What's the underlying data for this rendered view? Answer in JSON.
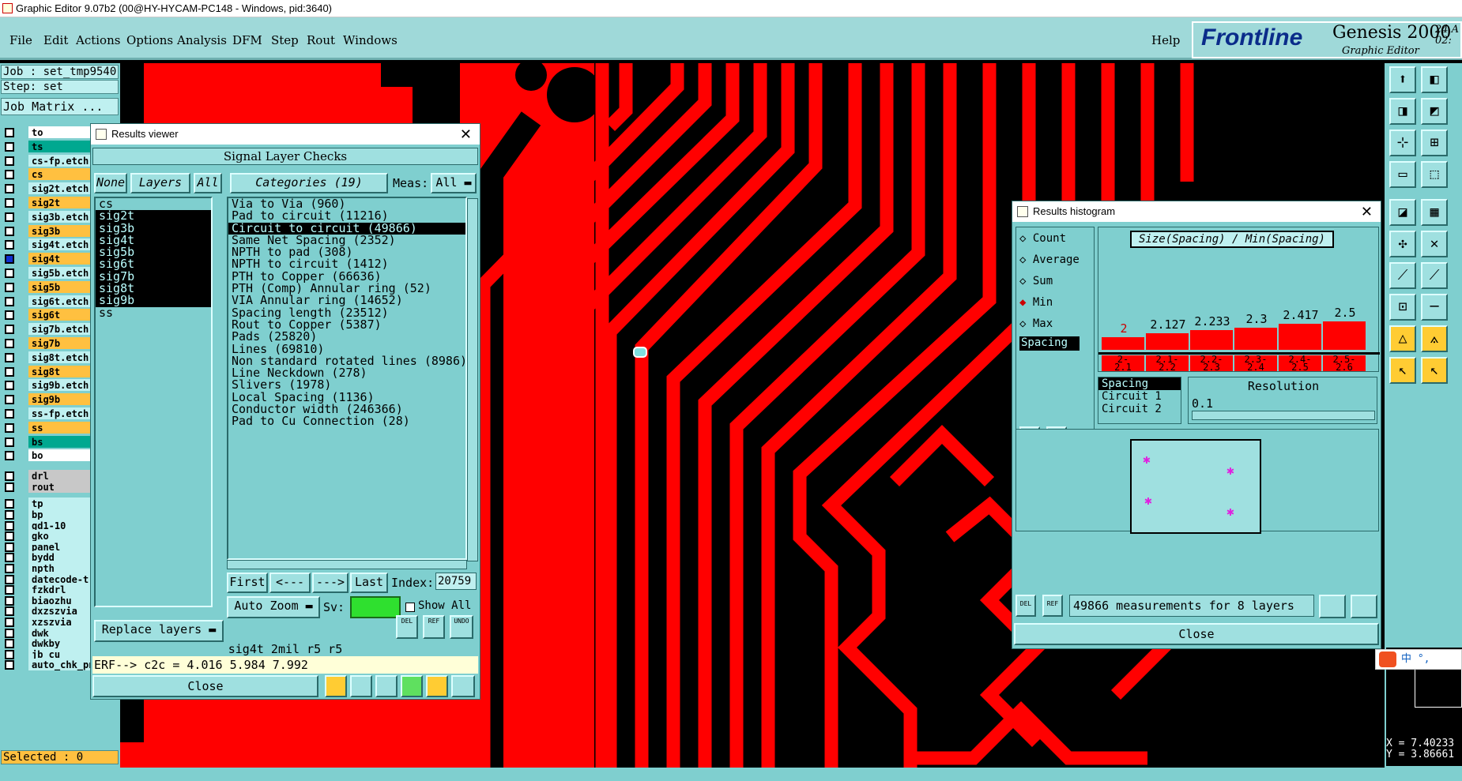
{
  "app": {
    "title": "Graphic Editor 9.07b2 (00@HY-HYCAM-PC148 - Windows, pid:3640)",
    "menu": [
      "File",
      "Edit",
      "Actions",
      "Options",
      "Analysis",
      "DFM",
      "Step",
      "Rout",
      "Windows"
    ],
    "help": "Help",
    "brand": "Frontline",
    "product": "Genesis 2000",
    "subtitle": "Graphic Editor",
    "date_line1": "24 A",
    "date_line2": "02:"
  },
  "left": {
    "job": "Job : set_tmp9540",
    "step": "Step: set",
    "job_matrix": "Job Matrix ...",
    "layers": [
      {
        "name": "to",
        "color": "#ffffff"
      },
      {
        "name": "ts",
        "color": "#00a890"
      },
      {
        "name": "cs-fp.etch",
        "color": "#bff0f0"
      },
      {
        "name": "cs",
        "color": "#ffc040"
      },
      {
        "name": "sig2t.etch",
        "color": "#bff0f0"
      },
      {
        "name": "sig2t",
        "color": "#ffc040"
      },
      {
        "name": "sig3b.etch",
        "color": "#bff0f0"
      },
      {
        "name": "sig3b",
        "color": "#ffc040"
      },
      {
        "name": "sig4t.etch",
        "color": "#bff0f0"
      },
      {
        "name": "sig4t",
        "color": "#ffc040"
      },
      {
        "name": "sig5b.etch",
        "color": "#bff0f0"
      },
      {
        "name": "sig5b",
        "color": "#ffc040"
      },
      {
        "name": "sig6t.etch",
        "color": "#bff0f0"
      },
      {
        "name": "sig6t",
        "color": "#ffc040"
      },
      {
        "name": "sig7b.etch",
        "color": "#bff0f0"
      },
      {
        "name": "sig7b",
        "color": "#ffc040"
      },
      {
        "name": "sig8t.etch",
        "color": "#bff0f0"
      },
      {
        "name": "sig8t",
        "color": "#ffc040"
      },
      {
        "name": "sig9b.etch",
        "color": "#bff0f0"
      },
      {
        "name": "sig9b",
        "color": "#ffc040"
      },
      {
        "name": "ss-fp.etch",
        "color": "#bff0f0"
      },
      {
        "name": "ss",
        "color": "#ffc040"
      },
      {
        "name": "bs",
        "color": "#00a890"
      },
      {
        "name": "bo",
        "color": "#ffffff"
      },
      {
        "name": "drl",
        "color": "#c8c8c8"
      },
      {
        "name": "rout",
        "color": "#c8c8c8"
      },
      {
        "name": "tp",
        "color": "#bff0f0"
      },
      {
        "name": "bp",
        "color": "#bff0f0"
      },
      {
        "name": "gd1-10",
        "color": "#bff0f0"
      },
      {
        "name": "gko",
        "color": "#bff0f0"
      },
      {
        "name": "panel",
        "color": "#bff0f0"
      },
      {
        "name": "bydd",
        "color": "#bff0f0"
      },
      {
        "name": "npth",
        "color": "#bff0f0"
      },
      {
        "name": "datecode-t",
        "color": "#bff0f0"
      },
      {
        "name": "fzkdrl",
        "color": "#bff0f0"
      },
      {
        "name": "biaozhu",
        "color": "#bff0f0"
      },
      {
        "name": "dxzszvia",
        "color": "#bff0f0"
      },
      {
        "name": "xzszvia",
        "color": "#bff0f0"
      },
      {
        "name": "dwk",
        "color": "#bff0f0"
      },
      {
        "name": "dwkby",
        "color": "#bff0f0"
      },
      {
        "name": "jb_cu",
        "color": "#bff0f0"
      },
      {
        "name": "auto_chk_pnl",
        "color": "#bff0f0"
      }
    ],
    "selected": "Selected : 0"
  },
  "results_viewer": {
    "title": "Results viewer",
    "header": "Signal Layer Checks",
    "none_btn": "None",
    "layers_btn": "Layers",
    "all_btn": "All",
    "categories_btn": "Categories (19)",
    "meas_label": "Meas:",
    "meas_value": "All",
    "layer_list": [
      "cs",
      "sig2t",
      "sig3b",
      "sig4t",
      "sig5b",
      "sig6t",
      "sig7b",
      "sig8t",
      "sig9b",
      "ss"
    ],
    "categories": [
      "Via to Via (960)",
      "Pad to circuit (11216)",
      "Circuit to circuit (49866)",
      "Same Net Spacing (2352)",
      "NPTH to pad (308)",
      "NPTH to circuit (1412)",
      "PTH to Copper (66636)",
      "PTH (Comp) Annular ring (52)",
      "VIA Annular ring (14652)",
      "Spacing length (23512)",
      "Rout to Copper (5387)",
      "Pads (25820)",
      "Lines (69810)",
      "Non standard rotated lines (8986)",
      "Line Neckdown (278)",
      "Slivers (1978)",
      "Local Spacing (1136)",
      "Conductor width (246366)",
      "Pad to Cu Connection (28)"
    ],
    "first": "First",
    "prev": "<---",
    "next": "--->",
    "last": "Last",
    "index_label": "Index:",
    "index_value": "20759",
    "auto_zoom": "Auto Zoom",
    "sv_label": "Sv:",
    "show_all": "Show All",
    "replace_layers": "Replace layers",
    "del": "DEL",
    "ref": "REF",
    "undo": "UNDO",
    "info_line": "sig4t 2mil  r5  r5",
    "erf_line": "ERF--> c2c = 4.016 5.984 7.992",
    "close": "Close"
  },
  "histogram": {
    "title": "Results histogram",
    "modes": [
      "Count",
      "Average",
      "Sum",
      "Min",
      "Max"
    ],
    "selected_mode": "Min",
    "chart_title": "Size(Spacing) / Min(Spacing)",
    "spacing_tag": "Spacing",
    "bar_values": [
      "2",
      "2.127",
      "2.233",
      "2.3",
      "2.417",
      "2.5"
    ],
    "bins": [
      [
        "2-",
        "2.1"
      ],
      [
        "2.1-",
        "2.2"
      ],
      [
        "2.2-",
        "2.3"
      ],
      [
        "2.3-",
        "2.4"
      ],
      [
        "2.4-",
        "2.5"
      ],
      [
        "2.5-",
        "2.6"
      ]
    ],
    "attr_list": [
      "Spacing",
      "Circuit 1",
      "Circuit 2"
    ],
    "resolution_label": "Resolution",
    "resolution_value": "0.1",
    "del": "DEL",
    "ref": "REF",
    "summary": "49866 measurements for 8 layers",
    "close": "Close"
  },
  "coords": {
    "x": "X = 7.40233",
    "y": "Y = 3.86661"
  },
  "ime": "中 °,",
  "chart_data": {
    "type": "bar",
    "title": "Size(Spacing) / Min(Spacing)",
    "categories": [
      "2-2.1",
      "2.1-2.2",
      "2.2-2.3",
      "2.3-2.4",
      "2.4-2.5",
      "2.5-2.6"
    ],
    "values": [
      2,
      2.127,
      2.233,
      2.3,
      2.417,
      2.5
    ]
  }
}
